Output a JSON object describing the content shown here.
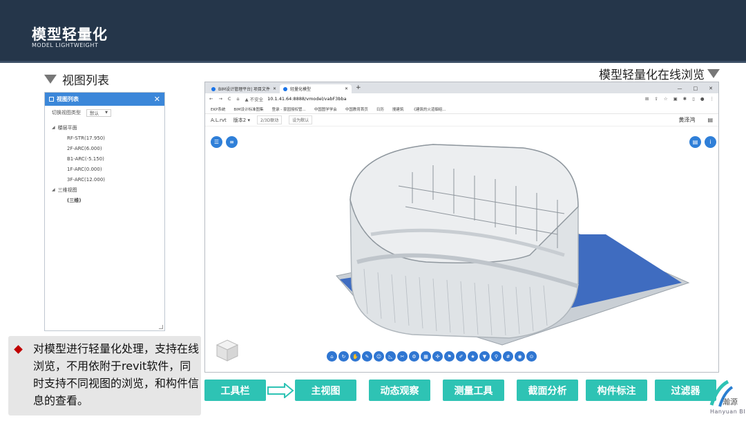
{
  "header": {
    "title": "模型轻量化",
    "subtitle": "MODEL LIGHTWEIGHT",
    "bg_color": "#25364a"
  },
  "left_section": {
    "heading": "视图列表"
  },
  "right_section": {
    "heading": "模型轻量化在线浏览"
  },
  "view_panel": {
    "title": "视图列表",
    "close_icon": "close-icon",
    "switch_label": "切换视图类型",
    "switch_value": "默认",
    "tree": [
      {
        "label": "楼层平面",
        "children": [
          "RF-STR(17.950)",
          "2F-ARC(6.000)",
          "B1-ARC(-5.150)",
          "1F-ARC(0.000)",
          "3F-ARC(12.000)"
        ]
      },
      {
        "label": "三维视图",
        "children": [
          "(三维)"
        ]
      }
    ]
  },
  "browser": {
    "tabs": [
      {
        "label": "BIM设计管理平台| 项目文件"
      },
      {
        "label": "轻量化模型"
      }
    ],
    "new_tab": "+",
    "window_controls": [
      "—",
      "□",
      "✕"
    ],
    "nav": [
      "←",
      "→",
      "C",
      "⌂"
    ],
    "security": "▲ 不安全",
    "url": "10.1.41.64:8888/vmodel/vabF3bba",
    "bookmarks": [
      "EKP系统",
      "BIM设计标准图集",
      "登录 - 豪园授权管...",
      "中国图学学会",
      "中国教育首页",
      "日历",
      "搜建筑",
      "《建筑的火道烟组..."
    ],
    "app_toolbar": {
      "model_name": "A.L.rvt",
      "version": "版本2 ▾",
      "btn_2d3d": "2/3D联动",
      "btn_default": "设为默认",
      "user": "黄泽鸿"
    }
  },
  "note": {
    "text": "对模型进行轻量化处理，支持在线浏览，不用依附于revit软件，同时支持不同视图的浏览，和构件信息的查看。",
    "accent": "#c00000"
  },
  "flow_buttons": [
    "工具栏",
    "主视图",
    "动态观察",
    "测量工具",
    "截面分析",
    "构件标注",
    "过滤器"
  ],
  "flow_color": "#2ec3b4",
  "logo": {
    "text": "瀚源",
    "sub": "Hanyuan BIM"
  }
}
